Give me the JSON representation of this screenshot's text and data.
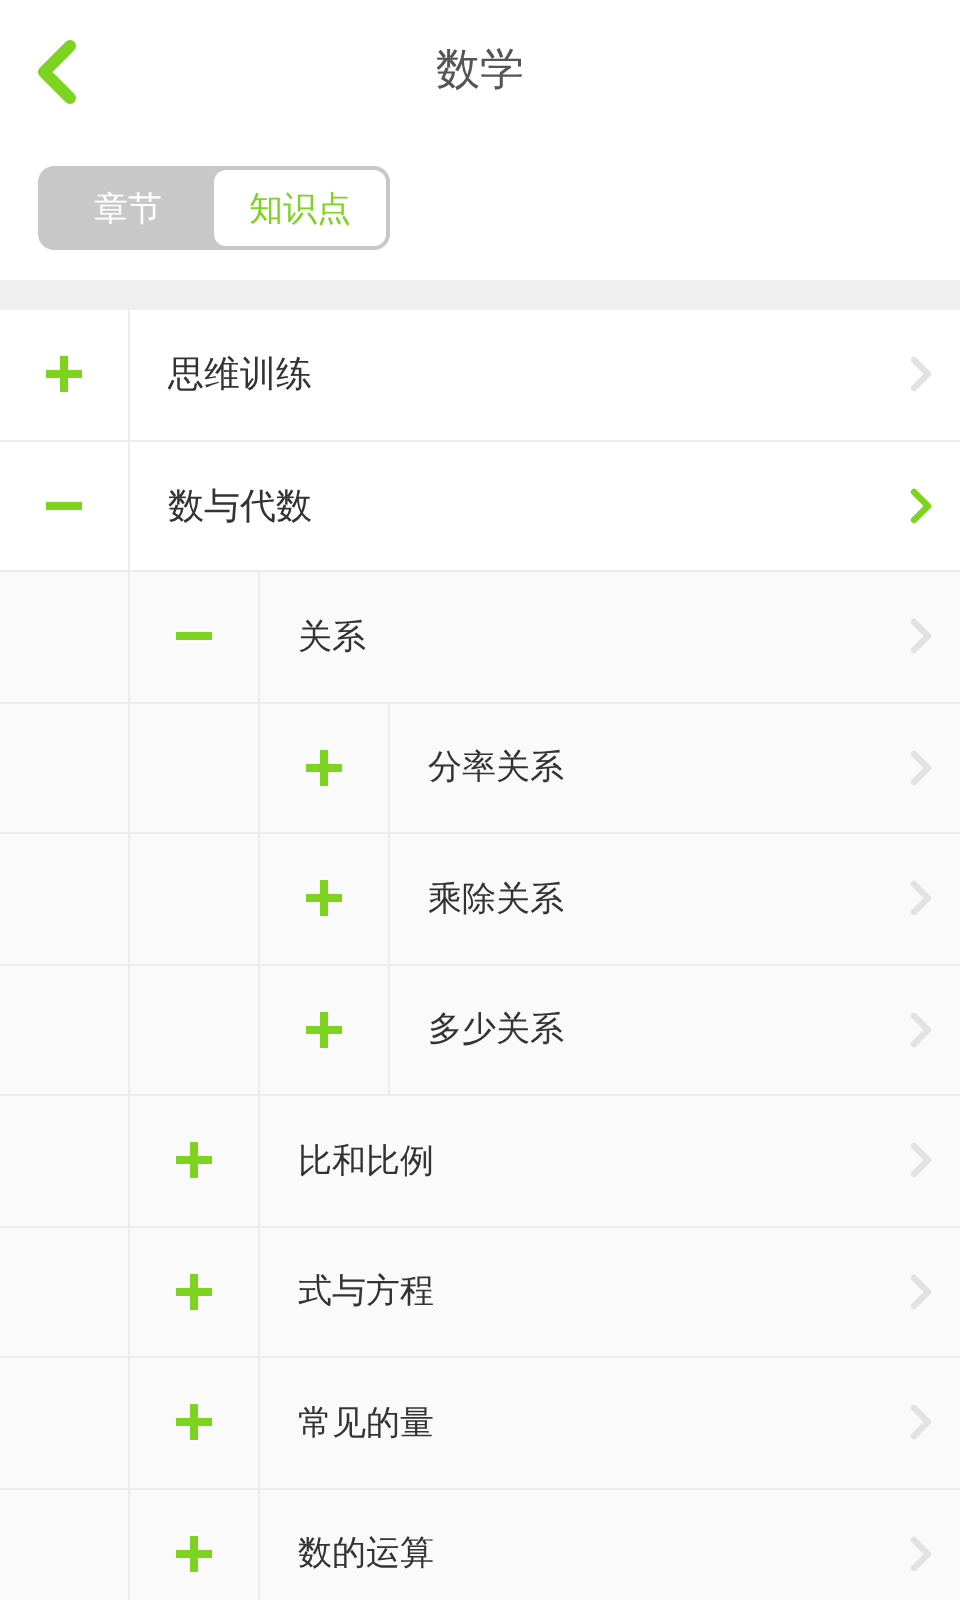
{
  "header": {
    "title": "数学"
  },
  "tabs": [
    {
      "label": "章节",
      "selected": false
    },
    {
      "label": "知识点",
      "selected": true
    }
  ],
  "tree": [
    {
      "label": "思维训练",
      "expanded": false,
      "selected": false
    },
    {
      "label": "数与代数",
      "expanded": true,
      "selected": true,
      "children": [
        {
          "label": "关系",
          "expanded": true,
          "selected": false,
          "children": [
            {
              "label": "分率关系",
              "expanded": false,
              "selected": false
            },
            {
              "label": "乘除关系",
              "expanded": false,
              "selected": false
            },
            {
              "label": "多少关系",
              "expanded": false,
              "selected": false
            }
          ]
        },
        {
          "label": "比和比例",
          "expanded": false,
          "selected": false
        },
        {
          "label": "式与方程",
          "expanded": false,
          "selected": false
        },
        {
          "label": "常见的量",
          "expanded": false,
          "selected": false
        },
        {
          "label": "数的运算",
          "expanded": false,
          "selected": false
        }
      ]
    }
  ]
}
